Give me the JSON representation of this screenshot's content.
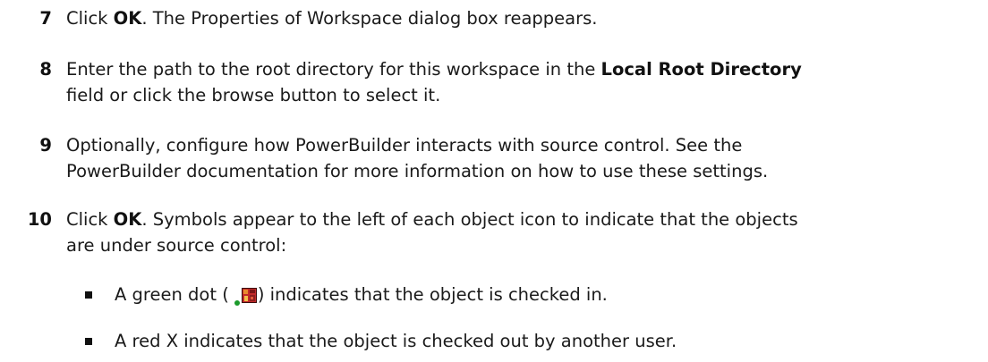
{
  "steps": [
    {
      "number": "7",
      "pre": "Click ",
      "bold": "OK",
      "post": ". The Properties of Workspace dialog box reappears."
    },
    {
      "number": "8",
      "line1_pre": "Enter the path to the root directory for this workspace in the ",
      "line1_bold": "Local Root Directory",
      "line2": "field or click the browse button to select it."
    },
    {
      "number": "9",
      "line1": "Optionally, configure how PowerBuilder interacts with source control. See the",
      "line2": "PowerBuilder documentation for more information on how to use these settings."
    },
    {
      "number": "10",
      "line1_pre": "Click ",
      "line1_bold": "OK",
      "line1_post": ". Symbols appear to the left of each object icon to indicate that the objects",
      "line2": "are under source control:"
    }
  ],
  "bullets": [
    {
      "pre": "A green dot (",
      "post": ") indicates that the object is checked in.",
      "icon": "checked-in-object-icon"
    },
    {
      "text": "A red X indicates that the object is checked out by another user."
    }
  ],
  "colors": {
    "text": "#1a1a1a",
    "green_dot": "#1b9a2b",
    "object_icon": "#b0202a"
  }
}
